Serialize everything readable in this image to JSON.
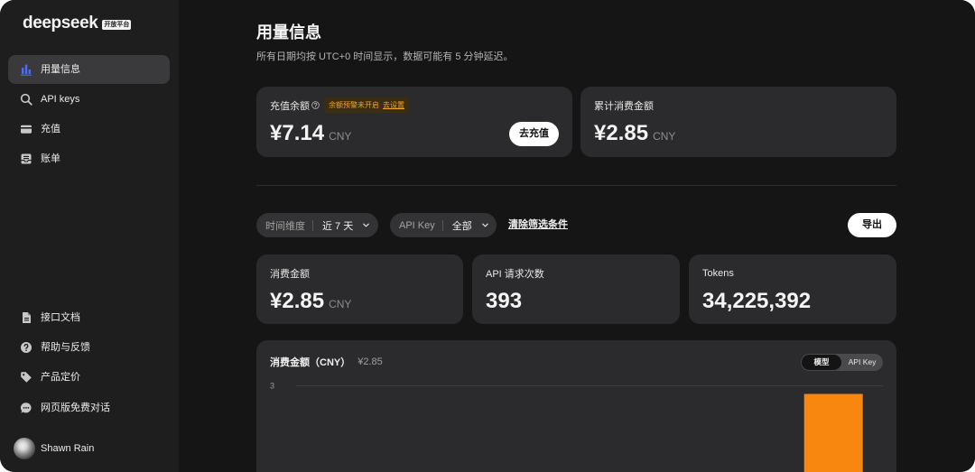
{
  "app": {
    "logo_text": "deepseek",
    "logo_badge": "开放平台"
  },
  "sidebar": {
    "top_items": [
      {
        "label": "用量信息",
        "icon": "bar-chart-icon",
        "active": true
      },
      {
        "label": "API keys",
        "icon": "search-icon",
        "active": false
      },
      {
        "label": "充值",
        "icon": "credit-card-icon",
        "active": false
      },
      {
        "label": "账单",
        "icon": "inbox-icon",
        "active": false
      }
    ],
    "bottom_items": [
      {
        "label": "接口文档",
        "icon": "document-icon"
      },
      {
        "label": "帮助与反馈",
        "icon": "help-icon"
      },
      {
        "label": "产品定价",
        "icon": "tag-icon"
      },
      {
        "label": "网页版免费对话",
        "icon": "chat-icon"
      }
    ],
    "user": {
      "name": "Shawn Rain"
    }
  },
  "header": {
    "title": "用量信息",
    "subtitle": "所有日期均按 UTC+0 时间显示，数据可能有 5 分钟延迟。"
  },
  "balance": {
    "label": "充值余额",
    "alert_text": "余额预警未开启",
    "alert_link": "去设置",
    "amount": "¥7.14",
    "currency": "CNY",
    "topup_label": "去充值"
  },
  "total_spend": {
    "label": "累计消费金额",
    "amount": "¥2.85",
    "currency": "CNY"
  },
  "filters": {
    "time": {
      "label": "时间维度",
      "value": "近 7 天"
    },
    "api_key": {
      "label": "API Key",
      "value": "全部"
    },
    "clear_label": "清除筛选条件",
    "export_label": "导出"
  },
  "stats": [
    {
      "label": "消费金额",
      "value": "¥2.85",
      "unit": "CNY"
    },
    {
      "label": "API 请求次数",
      "value": "393"
    },
    {
      "label": "Tokens",
      "value": "34,225,392"
    }
  ],
  "chart_panel": {
    "title": "消费金额（CNY）",
    "total": "¥2.85",
    "toggle": {
      "model": "模型",
      "api_key": "API Key",
      "selected": "模型"
    }
  },
  "chart_data": {
    "type": "bar",
    "values": [
      0,
      0,
      0,
      0,
      0,
      0,
      2.85
    ],
    "y_ticks": [
      3
    ],
    "ylim": [
      0,
      3
    ]
  },
  "colors": {
    "accent": "#4d6bfe",
    "chart_bar": "#f7870f",
    "alert": "#f5a524"
  }
}
